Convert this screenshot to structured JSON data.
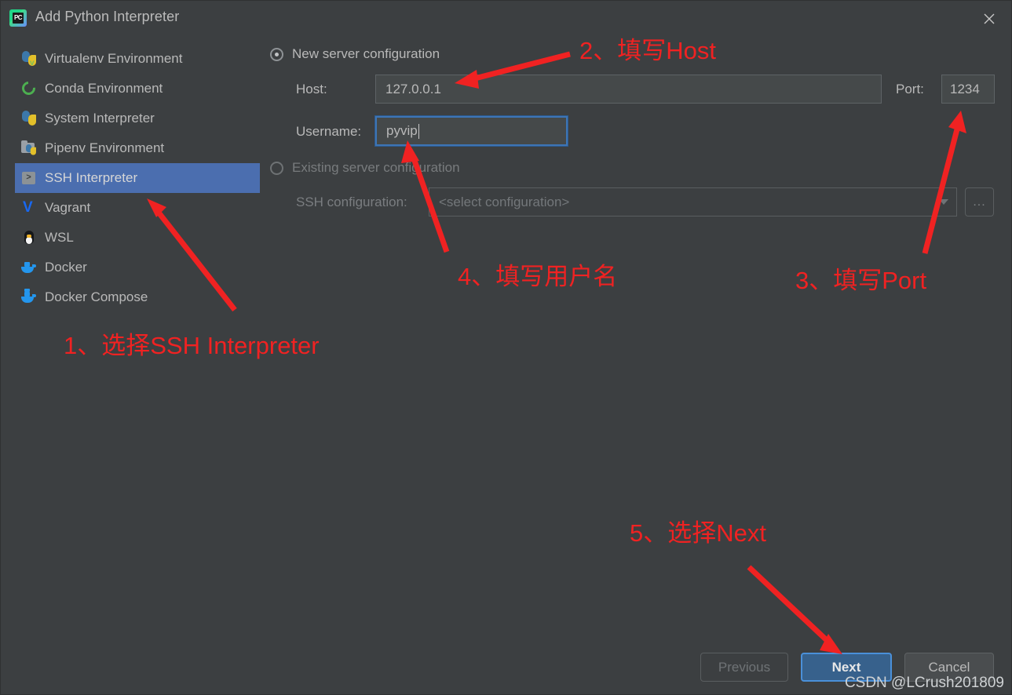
{
  "window": {
    "title": "Add Python Interpreter",
    "app_icon": "pycharm-icon",
    "icon_text": "PC",
    "close_icon": "close-icon"
  },
  "sidebar": {
    "items": [
      {
        "label": "Virtualenv Environment",
        "icon": "python-venv-icon",
        "selected": false
      },
      {
        "label": "Conda Environment",
        "icon": "conda-icon",
        "selected": false
      },
      {
        "label": "System Interpreter",
        "icon": "python-icon",
        "selected": false
      },
      {
        "label": "Pipenv Environment",
        "icon": "pipenv-folder-icon",
        "selected": false
      },
      {
        "label": "SSH Interpreter",
        "icon": "ssh-terminal-icon",
        "selected": true
      },
      {
        "label": "Vagrant",
        "icon": "vagrant-icon",
        "selected": false
      },
      {
        "label": "WSL",
        "icon": "linux-tux-icon",
        "selected": false
      },
      {
        "label": "Docker",
        "icon": "docker-whale-icon",
        "selected": false
      },
      {
        "label": "Docker Compose",
        "icon": "docker-compose-icon",
        "selected": false
      }
    ],
    "selected_index": 4
  },
  "main": {
    "new_server": {
      "radio_label": "New server configuration",
      "selected": true,
      "host_label": "Host:",
      "host_value": "127.0.0.1",
      "port_label": "Port:",
      "port_value": "1234",
      "username_label": "Username:",
      "username_value": "pyvip",
      "username_focused": true
    },
    "existing_server": {
      "radio_label": "Existing server configuration",
      "selected": false,
      "ssh_config_label": "SSH configuration:",
      "ssh_config_value": "<select configuration>",
      "browse_label": "...",
      "dropdown_icon": "chevron-down-icon"
    }
  },
  "footer": {
    "previous_label": "Previous",
    "next_label": "Next",
    "cancel_label": "Cancel"
  },
  "annotations": [
    {
      "id": "step-1",
      "text": "1、选择SSH Interpreter"
    },
    {
      "id": "step-2",
      "text": "2、填写Host"
    },
    {
      "id": "step-3",
      "text": "3、填写Port"
    },
    {
      "id": "step-4",
      "text": "4、填写用户名"
    },
    {
      "id": "step-5",
      "text": "5、选择Next"
    }
  ],
  "watermark": "CSDN @LCrush201809",
  "colors": {
    "window_bg": "#3c3f41",
    "selection_blue": "#4b6eaf",
    "primary_button": "#37618c",
    "focus_border": "#4a90d9",
    "annotation_red": "#f02222",
    "text": "#b9b9b9"
  }
}
